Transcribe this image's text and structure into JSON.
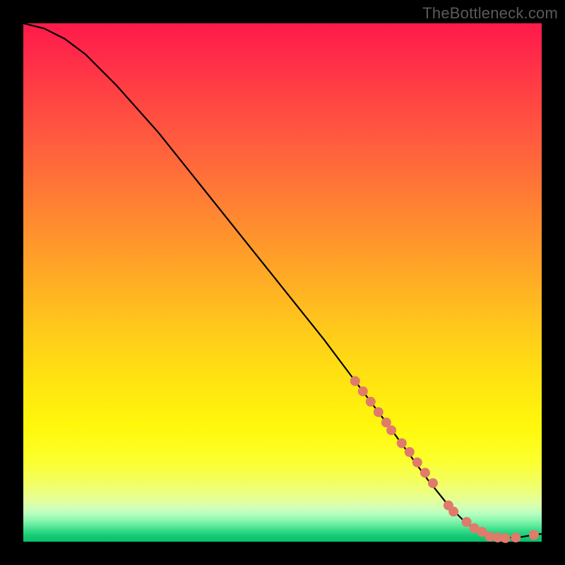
{
  "watermark": "TheBottleneck.com",
  "chart_data": {
    "type": "line",
    "title": "",
    "xlabel": "",
    "ylabel": "",
    "xlim": [
      0,
      100
    ],
    "ylim": [
      0,
      100
    ],
    "grid": false,
    "series": [
      {
        "name": "curve",
        "x": [
          0,
          4,
          8,
          12,
          18,
          26,
          34,
          42,
          50,
          58,
          64,
          70,
          74,
          78,
          82,
          85,
          88,
          90,
          93,
          96,
          99,
          100
        ],
        "y": [
          100,
          99,
          97,
          94,
          88,
          79,
          69,
          59,
          49,
          39,
          31,
          23,
          17.5,
          12,
          7,
          4,
          1.8,
          1.0,
          0.7,
          0.9,
          1.4,
          1.5
        ]
      }
    ],
    "markers": {
      "name": "highlight-points",
      "x": [
        64,
        65.5,
        67,
        68.5,
        70,
        71,
        73,
        74.5,
        76,
        77.5,
        79,
        82,
        83,
        85.5,
        87,
        88.5,
        90,
        91.5,
        93,
        95,
        98.5
      ],
      "y": [
        31,
        29,
        27,
        25,
        23,
        21.5,
        19,
        17.3,
        15.3,
        13.3,
        11.3,
        7.0,
        5.8,
        3.8,
        2.6,
        1.9,
        1.0,
        0.8,
        0.7,
        0.8,
        1.3
      ]
    },
    "gradient_stops": [
      {
        "pct": 0,
        "color": "#ff1a4b"
      },
      {
        "pct": 50,
        "color": "#ffb020"
      },
      {
        "pct": 80,
        "color": "#fff80c"
      },
      {
        "pct": 95,
        "color": "#9cf7b4"
      },
      {
        "pct": 100,
        "color": "#0abf6c"
      }
    ]
  }
}
